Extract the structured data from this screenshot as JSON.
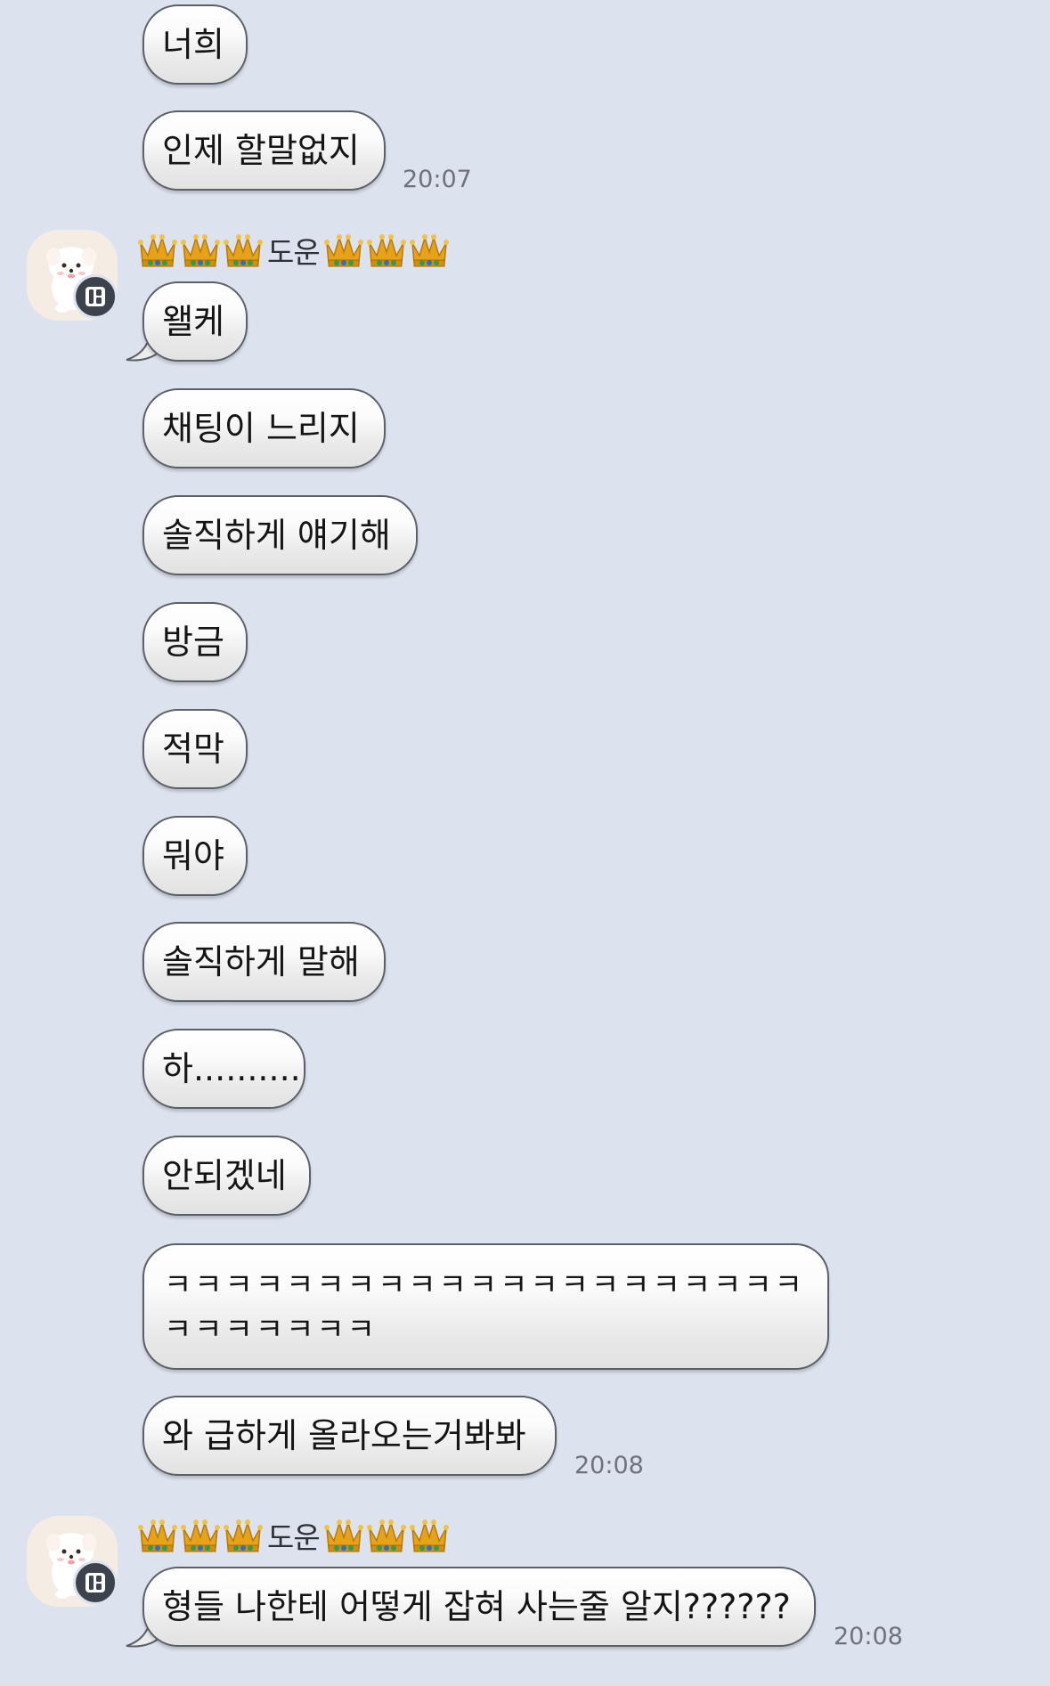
{
  "messages_top": [
    {
      "text": "너희"
    },
    {
      "text": "인제 할말없지",
      "time": "20:07"
    }
  ],
  "group1": {
    "sender": "도운",
    "crown_icon": "crown-emoji",
    "messages": [
      {
        "text": "왤케"
      },
      {
        "text": "채팅이 느리지"
      },
      {
        "text": "솔직하게 얘기해"
      },
      {
        "text": "방금"
      },
      {
        "text": "적막"
      },
      {
        "text": "뭐야"
      },
      {
        "text": "솔직하게 말해"
      },
      {
        "text": "하.........."
      },
      {
        "text": "안되겠네"
      },
      {
        "text": "ㅋㅋㅋㅋㅋㅋㅋㅋㅋㅋㅋㅋㅋㅋㅋㅋㅋㅋㅋㅋㅋㅋㅋㅋㅋㅋㅋㅋ"
      },
      {
        "text": "와 급하게 올라오는거봐봐",
        "time": "20:08"
      }
    ]
  },
  "group2": {
    "sender": "도운",
    "crown_icon": "crown-emoji",
    "messages": [
      {
        "text": "형들 나한테 어떻게 잡혀 사는줄 알지??????",
        "time": "20:08"
      }
    ]
  },
  "colors": {
    "background": "#dde3ee",
    "bubble_border": "#5b5f66",
    "timestamp": "#6d727b",
    "avatar_bg": "#f5ece4",
    "badge_bg": "#3d434c"
  }
}
